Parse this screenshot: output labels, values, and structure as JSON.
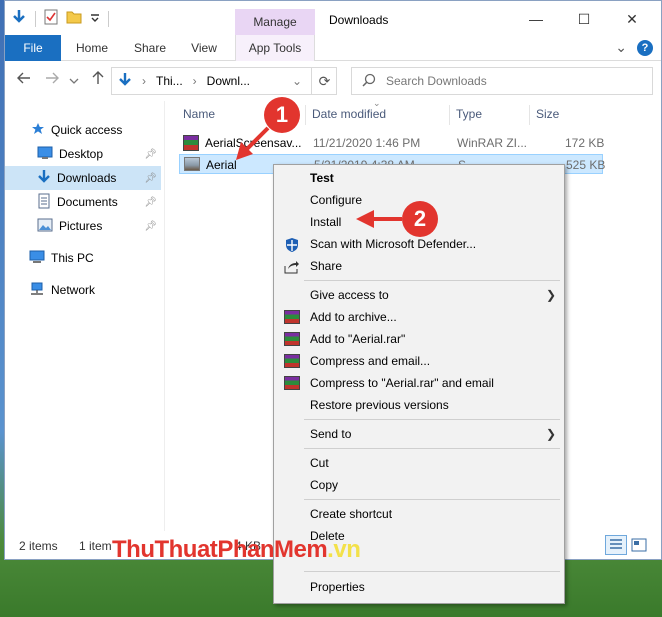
{
  "window": {
    "title": "Downloads",
    "manage_label": "Manage",
    "controls": {
      "minimize": "—",
      "maximize": "☐",
      "close": "✕"
    }
  },
  "ribbon": {
    "tabs": [
      "File",
      "Home",
      "Share",
      "View",
      "App Tools"
    ],
    "help_icon": "?",
    "expand_icon": "⌄"
  },
  "address": {
    "path": [
      "Thi...",
      "Downl..."
    ],
    "search_placeholder": "Search Downloads"
  },
  "navpane": {
    "items": [
      {
        "label": "Quick access",
        "icon": "star-icon"
      },
      {
        "label": "Desktop",
        "icon": "desktop-icon",
        "pinned": true
      },
      {
        "label": "Downloads",
        "icon": "download-icon",
        "pinned": true,
        "selected": true
      },
      {
        "label": "Documents",
        "icon": "documents-icon",
        "pinned": true
      },
      {
        "label": "Pictures",
        "icon": "pictures-icon",
        "pinned": true
      },
      {
        "label": "This PC",
        "icon": "computer-icon"
      },
      {
        "label": "Network",
        "icon": "network-icon"
      }
    ]
  },
  "filelist": {
    "columns": [
      "Name",
      "Date modified",
      "Type",
      "Size"
    ],
    "rows": [
      {
        "name": "AerialScreensav...",
        "date": "11/21/2020 1:46 PM",
        "type": "WinRAR ZI...",
        "size": "172 KB"
      },
      {
        "name": "Aerial",
        "date": "5/21/2019 4:38 AM",
        "type": "S...",
        "size": "525 KB"
      }
    ]
  },
  "statusbar": {
    "items_count": "2 items",
    "selected": "1 item",
    "size": "4 KB"
  },
  "context_menu": {
    "items": [
      {
        "label": "Test",
        "bold": true
      },
      {
        "label": "Configure"
      },
      {
        "label": "Install"
      },
      {
        "label": "Scan with Microsoft Defender...",
        "icon": "defender-shield-icon"
      },
      {
        "label": "Share",
        "icon": "share-icon"
      },
      {
        "label": "Give access to",
        "submenu": true
      },
      {
        "label": "Add to archive...",
        "icon": "winrar-icon"
      },
      {
        "label": "Add to \"Aerial.rar\"",
        "icon": "winrar-icon"
      },
      {
        "label": "Compress and email...",
        "icon": "winrar-icon"
      },
      {
        "label": "Compress to \"Aerial.rar\" and email",
        "icon": "winrar-icon"
      },
      {
        "label": "Restore previous versions"
      },
      {
        "label": "Send to",
        "submenu": true
      },
      {
        "label": "Cut"
      },
      {
        "label": "Copy"
      },
      {
        "label": "Create shortcut"
      },
      {
        "label": "Delete"
      },
      {
        "label": "Properties"
      }
    ]
  },
  "annotations": {
    "step1": "1",
    "step2": "2"
  },
  "watermark": {
    "part1": "ThuThuat",
    "part2": "PhanMem",
    "part3": ".vn"
  },
  "colors": {
    "accent": "#1a6fc1",
    "selection": "#cce8ff",
    "annotation": "#e2352e"
  }
}
